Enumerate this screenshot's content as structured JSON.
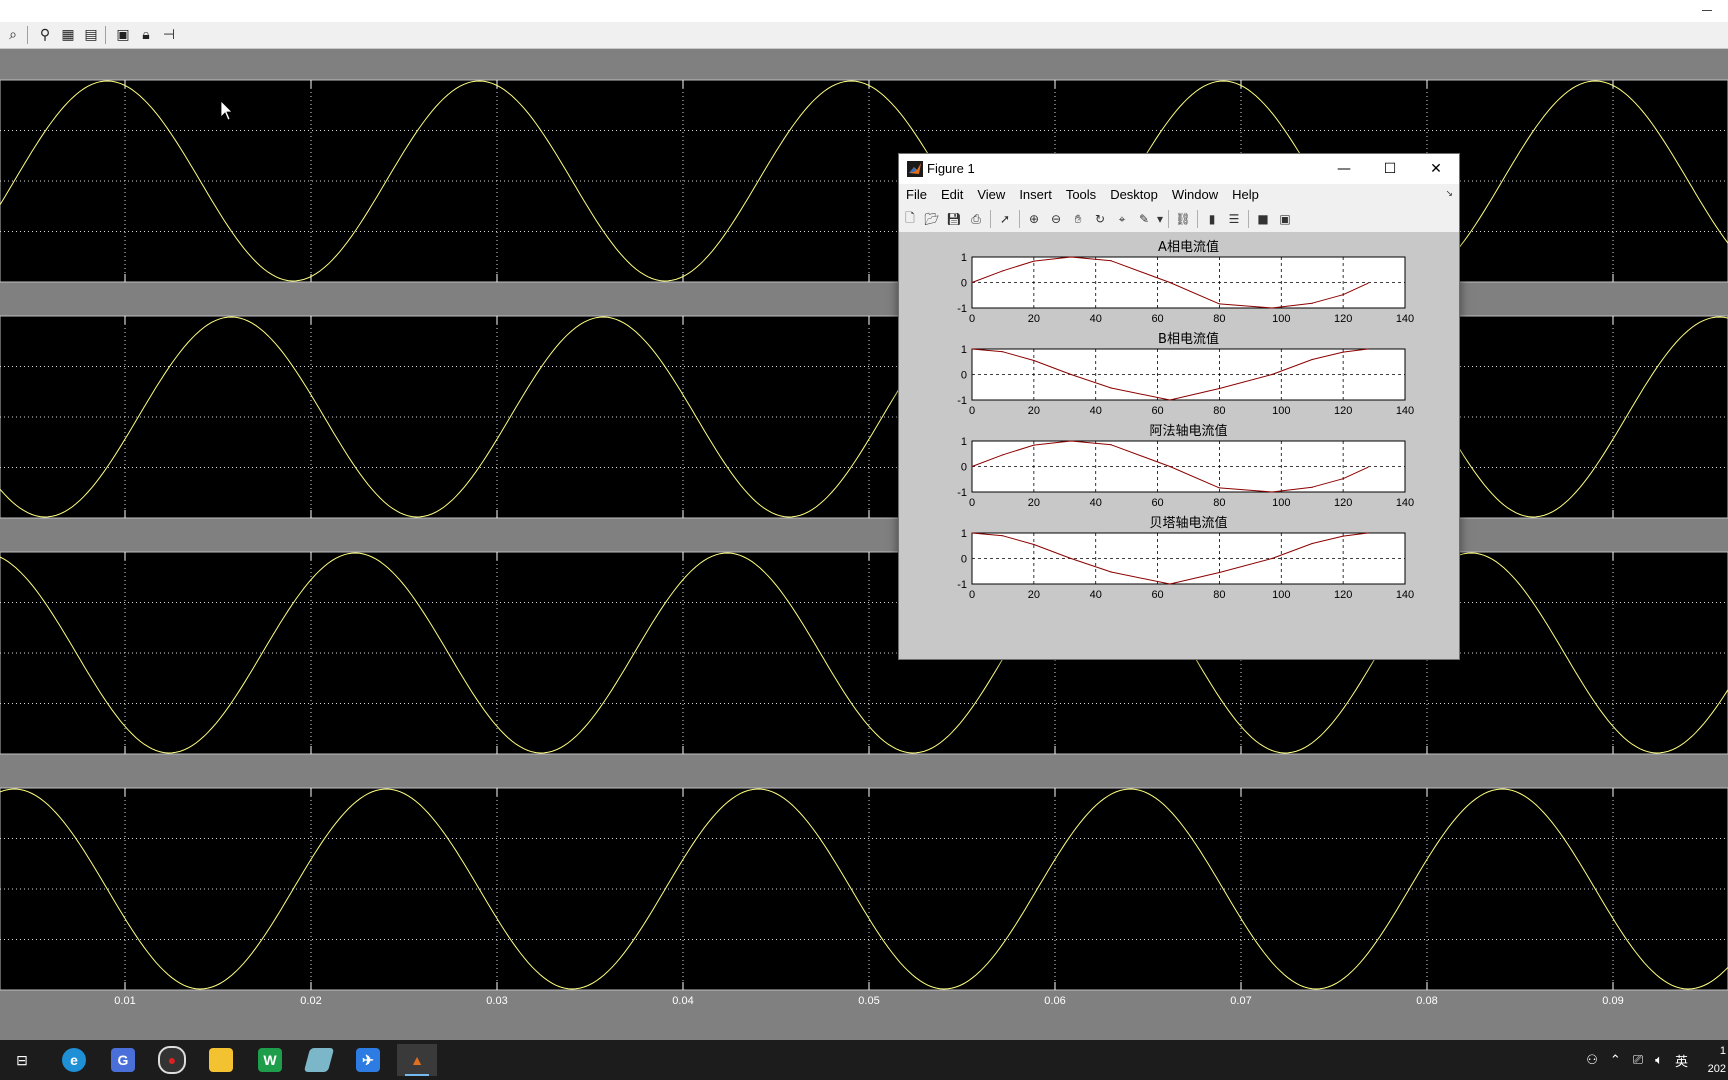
{
  "scope": {
    "toolbar_icons": [
      "zoom-icon",
      "binoculars-icon",
      "autoscale-icon",
      "save-axes-icon",
      "parameters-icon",
      "lock-icon",
      "floating-scope-icon"
    ],
    "x_tick_labels": [
      "0.01",
      "0.02",
      "0.03",
      "0.04",
      "0.05",
      "0.06",
      "0.07",
      "0.08",
      "0.09"
    ],
    "trace_color": "#ffff80",
    "background": "#000000"
  },
  "figure": {
    "title": "Figure 1",
    "menu": [
      "File",
      "Edit",
      "View",
      "Insert",
      "Tools",
      "Desktop",
      "Window",
      "Help"
    ],
    "toolbar_icons": [
      "new-figure-icon",
      "open-icon",
      "save-icon",
      "print-icon",
      "pointer-icon",
      "zoom-in-icon",
      "zoom-out-icon",
      "pan-icon",
      "rotate-icon",
      "data-cursor-icon",
      "brush-icon",
      "link-icon",
      "colorbar-icon",
      "legend-icon",
      "hide-plot-tools-icon",
      "show-plot-tools-icon"
    ],
    "subplots": [
      {
        "title": "A相电流值"
      },
      {
        "title": "B相电流值"
      },
      {
        "title": "阿法轴电流值"
      },
      {
        "title": "贝塔轴电流值"
      }
    ],
    "y_ticks": [
      "1",
      "0",
      "-1"
    ],
    "x_ticks": [
      "0",
      "20",
      "40",
      "60",
      "80",
      "100",
      "120",
      "140"
    ]
  },
  "chart_data": [
    {
      "type": "line",
      "title": "A相电流值",
      "xlim": [
        0,
        140
      ],
      "ylim": [
        -1,
        1
      ],
      "grid": true,
      "series": [
        {
          "x": [
            0,
            10,
            20,
            32,
            45,
            64,
            80,
            97,
            110,
            120,
            128
          ],
          "y": [
            0,
            0.46,
            0.84,
            1,
            0.85,
            0,
            -0.84,
            -1,
            -0.81,
            -0.48,
            -0.03
          ]
        }
      ],
      "color": "#8b0000"
    },
    {
      "type": "line",
      "title": "B相电流值",
      "xlim": [
        0,
        140
      ],
      "ylim": [
        -1,
        1
      ],
      "grid": true,
      "series": [
        {
          "x": [
            0,
            10,
            20,
            32,
            45,
            64,
            80,
            97,
            110,
            120,
            128
          ],
          "y": [
            1,
            0.89,
            0.55,
            0,
            -0.53,
            -1,
            -0.55,
            0,
            0.59,
            0.88,
            1
          ]
        }
      ],
      "color": "#8b0000"
    },
    {
      "type": "line",
      "title": "阿法轴电流值",
      "xlim": [
        0,
        140
      ],
      "ylim": [
        -1,
        1
      ],
      "grid": true,
      "series": [
        {
          "x": [
            0,
            10,
            20,
            32,
            45,
            64,
            80,
            97,
            110,
            120,
            128
          ],
          "y": [
            0,
            0.46,
            0.84,
            1,
            0.85,
            0,
            -0.84,
            -1,
            -0.81,
            -0.48,
            -0.03
          ]
        }
      ],
      "color": "#8b0000"
    },
    {
      "type": "line",
      "title": "贝塔轴电流值",
      "xlim": [
        0,
        140
      ],
      "ylim": [
        -1,
        1
      ],
      "grid": true,
      "series": [
        {
          "x": [
            0,
            10,
            20,
            32,
            45,
            64,
            80,
            97,
            110,
            120,
            128
          ],
          "y": [
            1,
            0.89,
            0.55,
            0,
            -0.53,
            -1,
            -0.55,
            0,
            0.59,
            0.88,
            1
          ]
        }
      ],
      "color": "#8b0000"
    }
  ],
  "taskbar": {
    "apps": [
      "task-view",
      "edge",
      "g-app",
      "recorder",
      "file-explorer",
      "wps-sheet",
      "stack-app",
      "feishu",
      "matlab"
    ],
    "tray": {
      "ime": "英",
      "clock_line1": "1",
      "clock_line2": "202"
    }
  }
}
